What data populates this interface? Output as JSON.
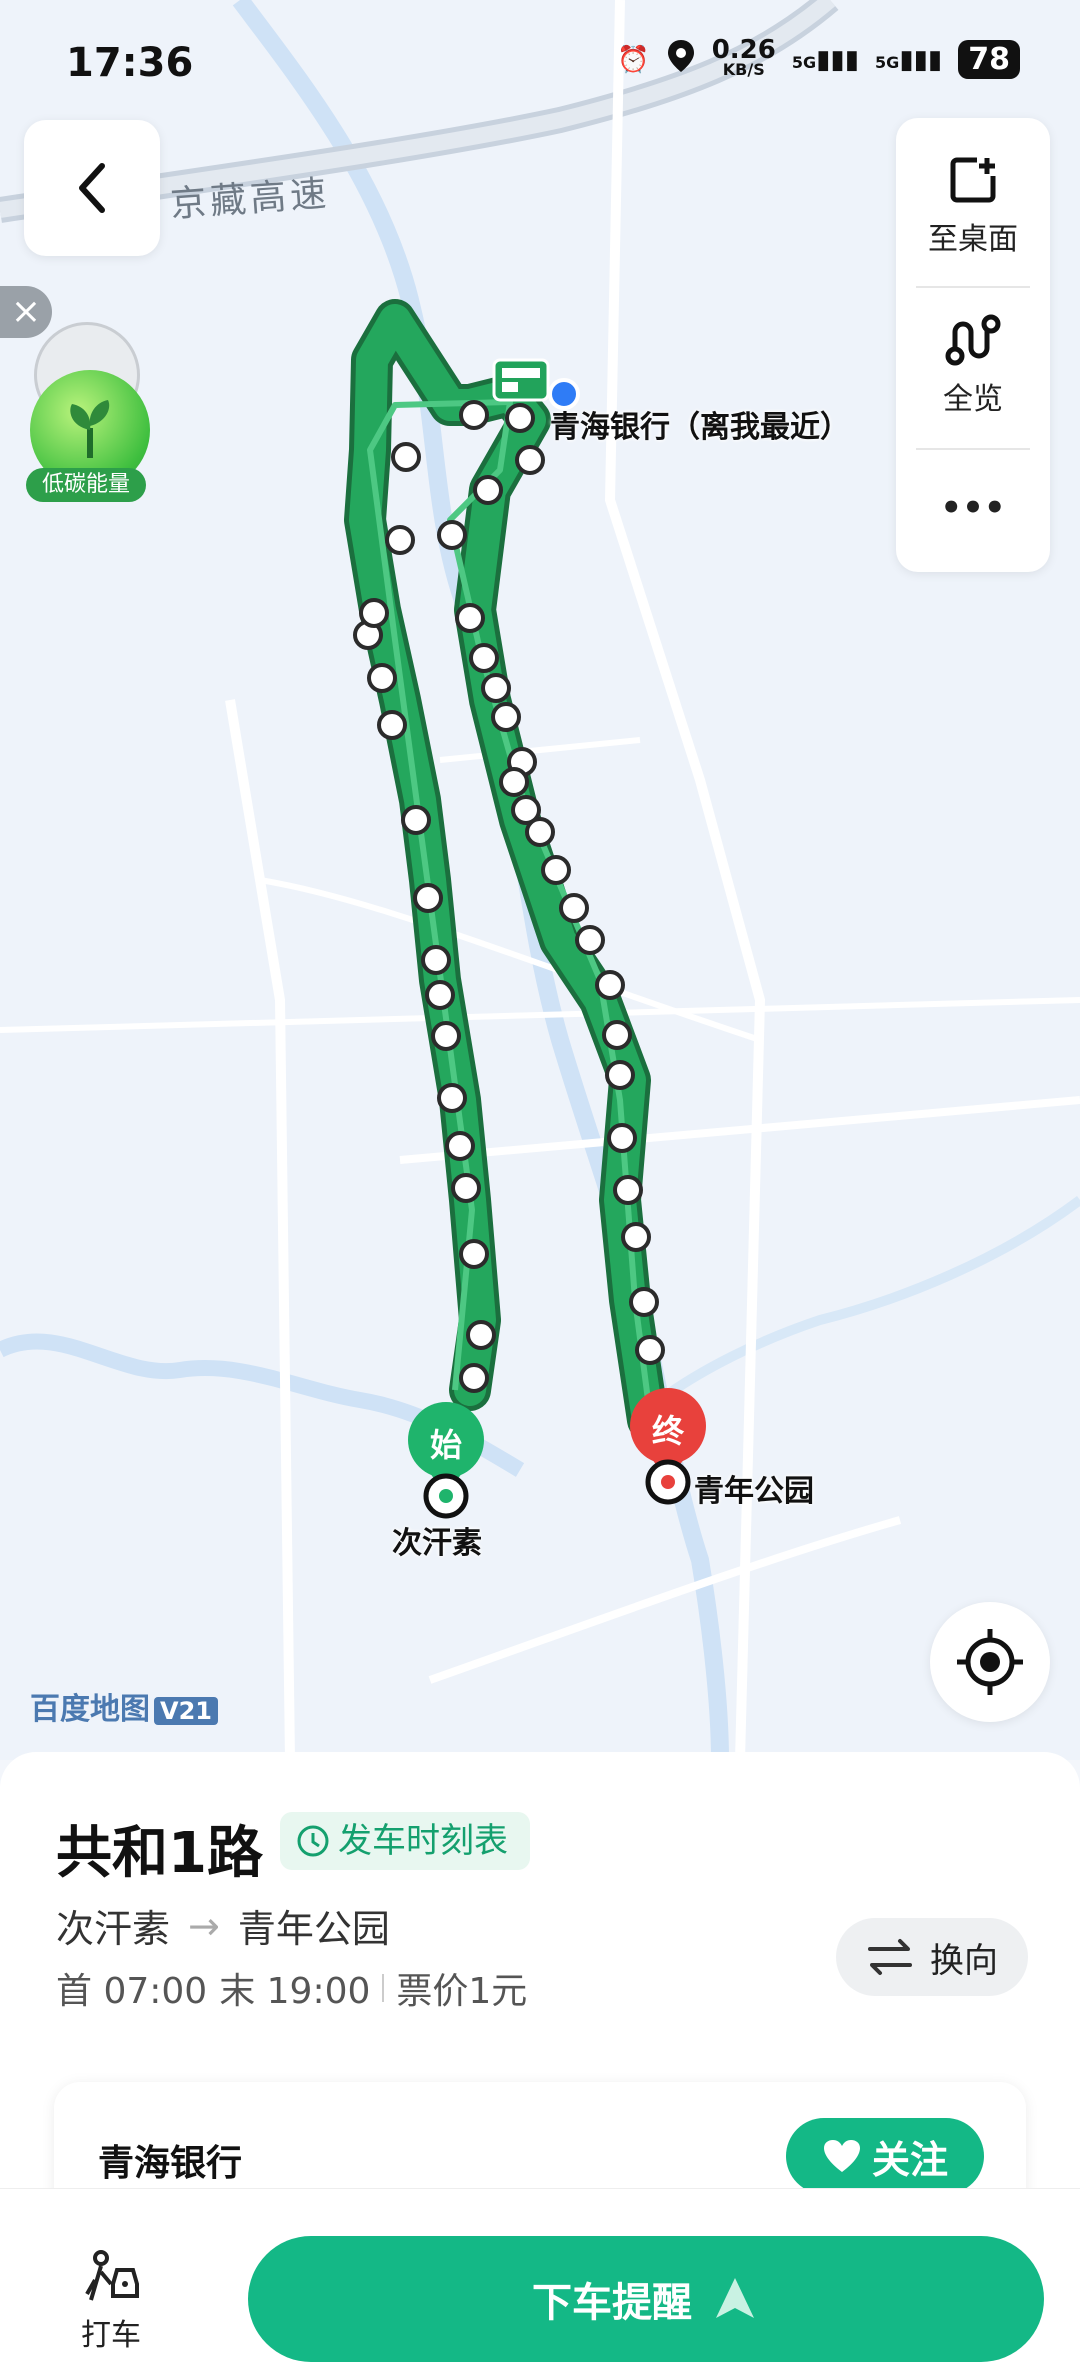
{
  "status_bar": {
    "time": "17:36",
    "net_speed": "0.26",
    "net_unit": "KB/S",
    "sim1": "5G",
    "sim2": "5G",
    "battery": "78"
  },
  "map": {
    "road_label": "京藏高速",
    "origin_marker": "始",
    "destination_marker": "终",
    "origin_stop": "次汗素",
    "destination_stop": "青年公园",
    "nearest_stop": "青海银行（离我最近）",
    "watermark": "百度地图",
    "watermark_version": "V21",
    "eco_badge": "低碳能量"
  },
  "side_panel": {
    "add_desktop": "至桌面",
    "overview": "全览",
    "more": "•••"
  },
  "route_info": {
    "line_name": "共和1路",
    "timetable_label": "发车时刻表",
    "from": "次汗素",
    "to": "青年公园",
    "first_bus": "首 07:00",
    "last_bus": "末 19:00",
    "fare": "票价1元",
    "switch_direction": "换向"
  },
  "stop_card": {
    "title": "青海银行",
    "follow_label": "关注"
  },
  "bottom_bar": {
    "taxi_label": "打车",
    "alert_label": "下车提醒"
  },
  "colors": {
    "route_green": "#1ea35a",
    "accent": "#14b886",
    "destination_red": "#e8413c"
  }
}
